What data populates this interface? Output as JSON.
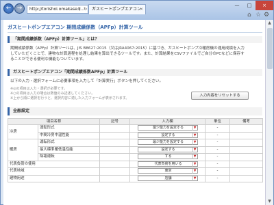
{
  "browser": {
    "address": "http://torishoi.omakase.c...",
    "tab_title": "ガスヒートポンプエアコン",
    "back_icon": "back-arrow-icon",
    "forward_icon": "forward-arrow-icon"
  },
  "page": {
    "title": "ガスヒートポンプエアコン 期間成績係数（APFp）計算ツール",
    "about_heading": "「期間成績係数（APFp）計算ツール」とは？",
    "about_lines": [
      "期間成績係数（APFp）計算ツールは、JIS B8627:2015（又はJRA4067:2015）に基づき、ガスヒートポンプ冷暖房機の運用成績を入力",
      "していただくことで、建物な計算過程を処理し結果を算出できるツールです。また、計算結果をCSVファイルでご自分のPCなどに保存す",
      "ることができる便利な機能もついています。"
    ],
    "tool_heading": "ガスヒートポンプエアコン「期間成績係数APFp」計算ツール",
    "instruction": "以下の入力・選択フォームに必要事項を入力して「計算実行」ボタンを押してください。",
    "notes": [
      "※◎の項目は入力・選択が必要です。",
      "※○の項目は入力の場合は数値のみ記述してください。",
      "※上から順に選択を行うと、選択内容に適した入力フォームが表示されます。"
    ],
    "reset_label": "入力内容をリセットする",
    "section_label": "全般設定"
  },
  "table": {
    "headers": [
      "項目名称",
      "記号",
      "入力欄",
      "単位",
      "備考"
    ],
    "rows": [
      {
        "group": "冷房",
        "item": "運転形式",
        "symbol": "",
        "value": "最少能力を設定する",
        "unit": "-",
        "note": ""
      },
      {
        "group": "",
        "item": "中間冷房中温性能",
        "symbol": "",
        "value": "設定する",
        "unit": "-",
        "note": ""
      },
      {
        "group": "暖房",
        "item": "運転形式",
        "symbol": "",
        "value": "最少能力を設定する",
        "unit": "-",
        "note": ""
      },
      {
        "group": "",
        "item": "最大標準暖低温性能",
        "symbol": "",
        "value": "設定する",
        "unit": "-",
        "note": ""
      },
      {
        "group": "",
        "item": "除霜運転",
        "symbol": "",
        "value": "する",
        "unit": "-",
        "note": ""
      },
      {
        "group": "代表負荷の使用",
        "item": "",
        "symbol": "",
        "value": "代表負荷を用いる",
        "unit": "-",
        "note": ""
      },
      {
        "group": "代表地域",
        "item": "",
        "symbol": "",
        "value": "東京",
        "unit": "-",
        "note": ""
      },
      {
        "group": "建物用途",
        "item": "",
        "symbol": "",
        "value": "店舗",
        "unit": "-",
        "note": ""
      }
    ]
  }
}
